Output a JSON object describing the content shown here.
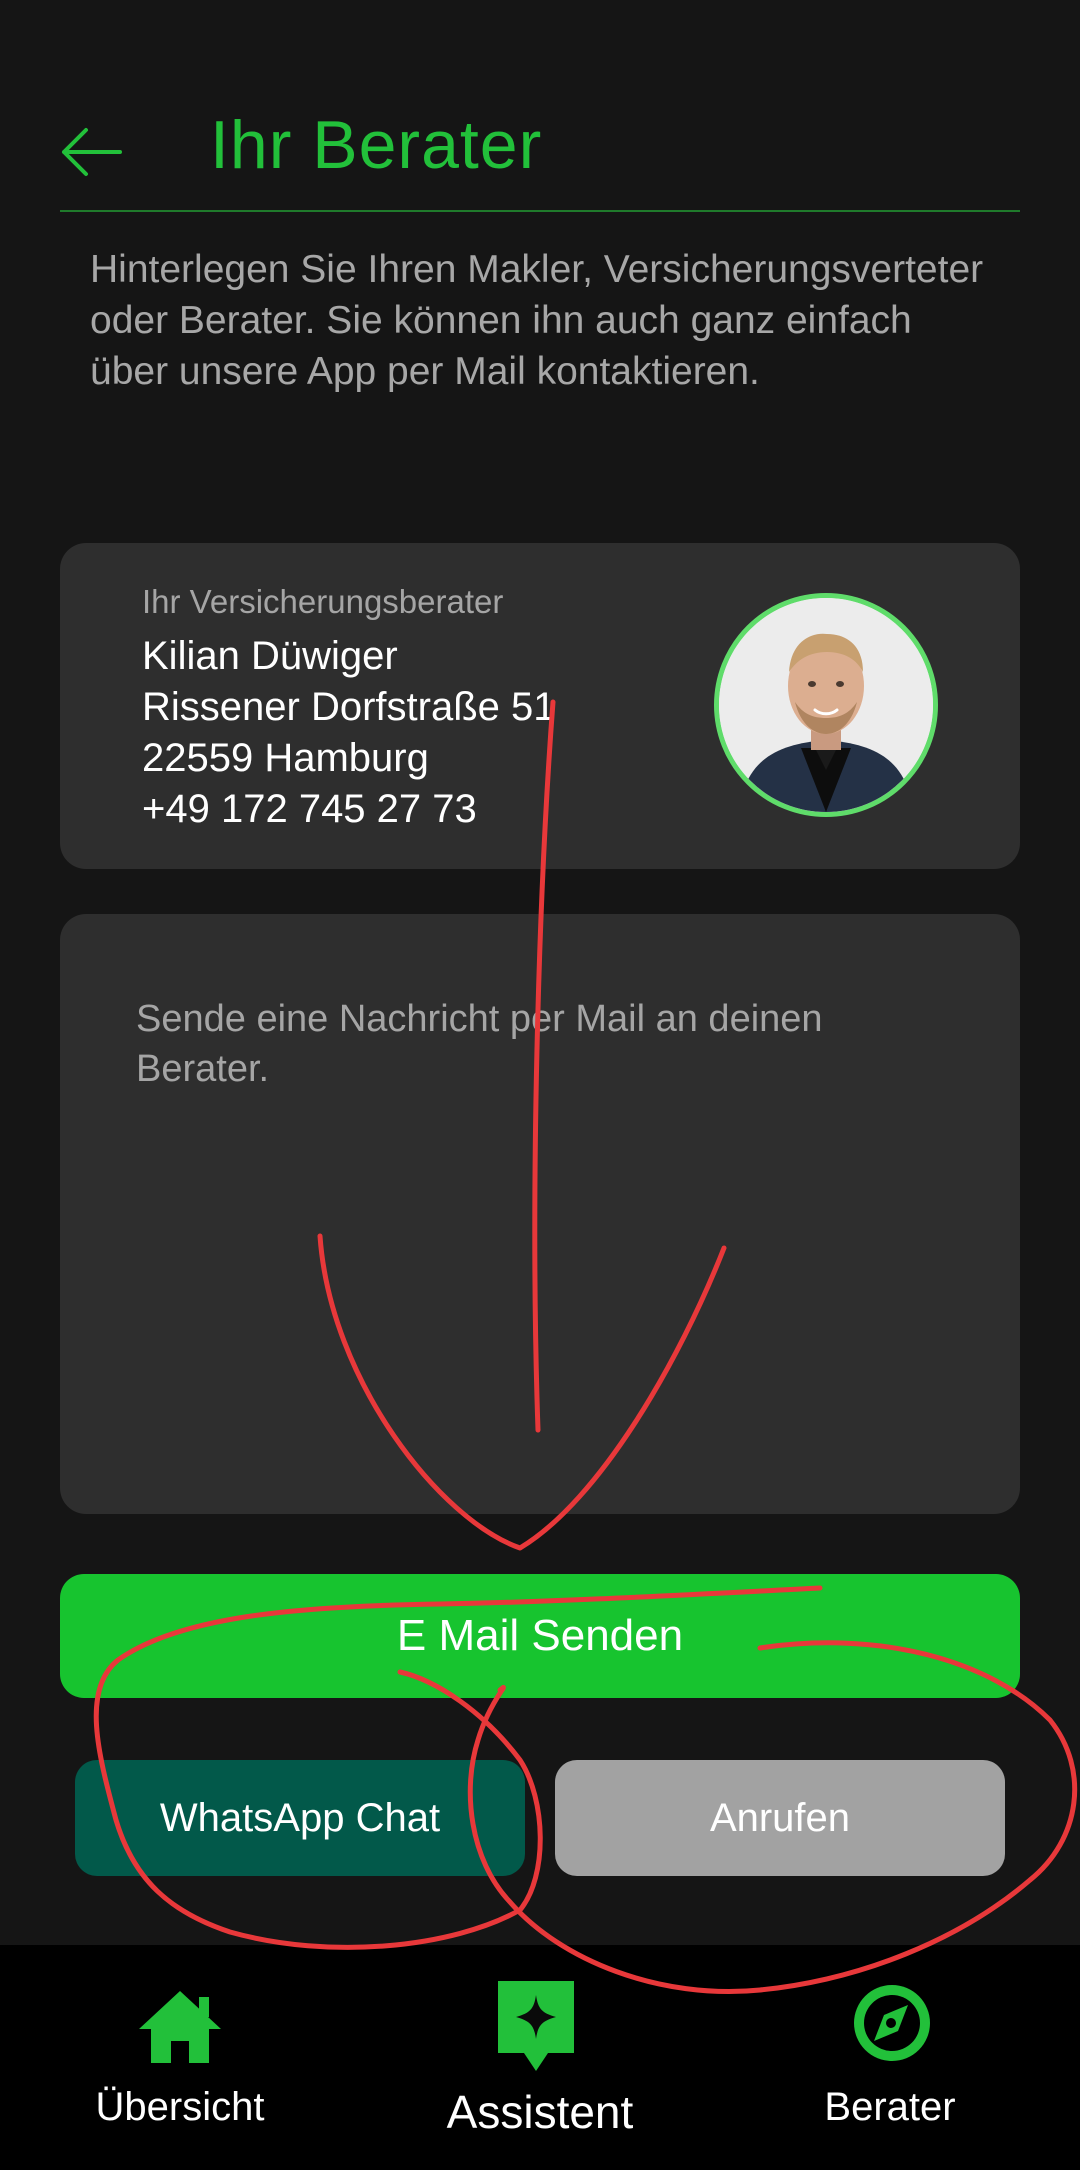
{
  "header": {
    "title": "Ihr Berater",
    "back_icon": "arrow-left-icon"
  },
  "intro": "Hinterlegen Sie Ihren Makler, Versicherungsverteter oder Berater. Sie können ihn auch ganz einfach über unsere App per Mail kontaktieren.",
  "advisor": {
    "label": "Ihr Versicherungsberater",
    "name": "Kilian Düwiger",
    "street": "Rissener Dorfstraße 51",
    "city": "22559 Hamburg",
    "phone": "+49 172 745 27 73"
  },
  "message": {
    "placeholder": "Sende eine Nachricht per Mail an deinen Berater."
  },
  "buttons": {
    "email": "E Mail Senden",
    "whatsapp": "WhatsApp Chat",
    "call": "Anrufen"
  },
  "bottom_nav": [
    {
      "label": "Übersicht",
      "icon": "home-icon"
    },
    {
      "label": "Assistent",
      "icon": "assistant-sparkle-icon"
    },
    {
      "label": "Berater",
      "icon": "compass-icon"
    }
  ],
  "colors": {
    "accent": "#17c42f",
    "title": "#22c03a",
    "background": "#151515",
    "card": "#2e2e2e",
    "whatsapp": "#02594a",
    "call": "#a2a2a2",
    "annotation": "#e8383a"
  }
}
